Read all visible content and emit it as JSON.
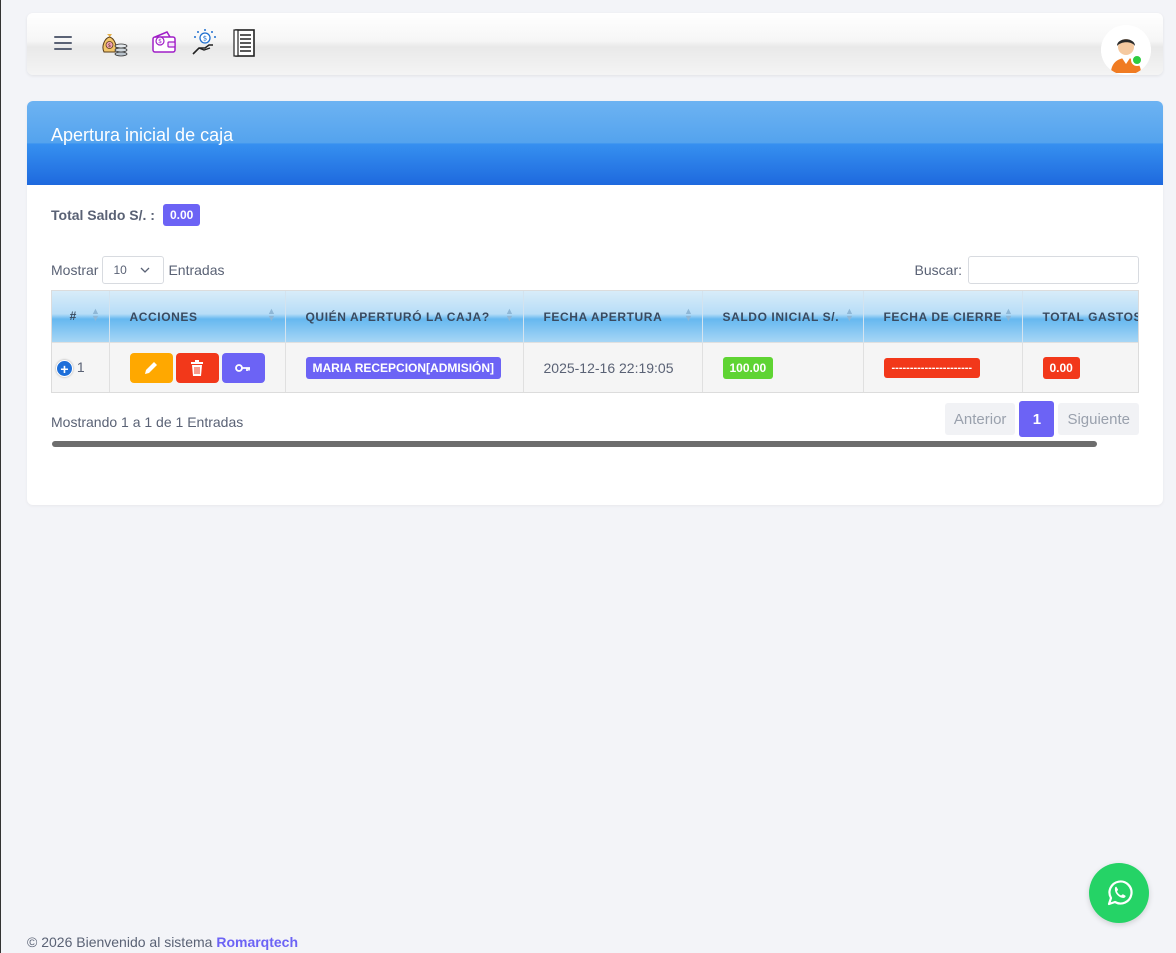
{
  "navbar": {
    "icons": [
      "money-bag-coins-icon",
      "wallet-money-icon",
      "hand-coin-icon",
      "receipt-list-icon"
    ]
  },
  "card": {
    "title": "Apertura inicial de caja",
    "saldo_label": "Total Saldo S/. :",
    "saldo_value": "0.00"
  },
  "controls": {
    "show_label": "Mostrar",
    "show_value": "10",
    "entries_label": "Entradas",
    "search_label": "Buscar:",
    "search_value": ""
  },
  "table": {
    "columns": [
      "#",
      "ACCIONES",
      "QUIÉN APERTURÓ LA CAJA?",
      "FECHA APERTURA",
      "SALDO INICIAL S/.",
      "FECHA DE CIERRE",
      "TOTAL GASTOS"
    ],
    "rows": [
      {
        "num": "1",
        "user": "MARIA RECEPCION[ADMISIÓN]",
        "fecha_apertura": "2025-12-16 22:19:05",
        "saldo_inicial": "100.00",
        "fecha_cierre": "----------------------",
        "total_gastos": "0.00"
      }
    ]
  },
  "pagination": {
    "info": "Mostrando 1 a 1 de 1 Entradas",
    "prev": "Anterior",
    "current": "1",
    "next": "Siguiente"
  },
  "footer": {
    "text": "© 2026 Bienvenido al sistema",
    "brand": "Romarqtech"
  },
  "colors": {
    "accent": "#6c63f5",
    "header_blue": "#1e69de",
    "success": "#5fd433",
    "danger": "#f2381a",
    "warning": "#ffa800",
    "whatsapp": "#25d366"
  }
}
